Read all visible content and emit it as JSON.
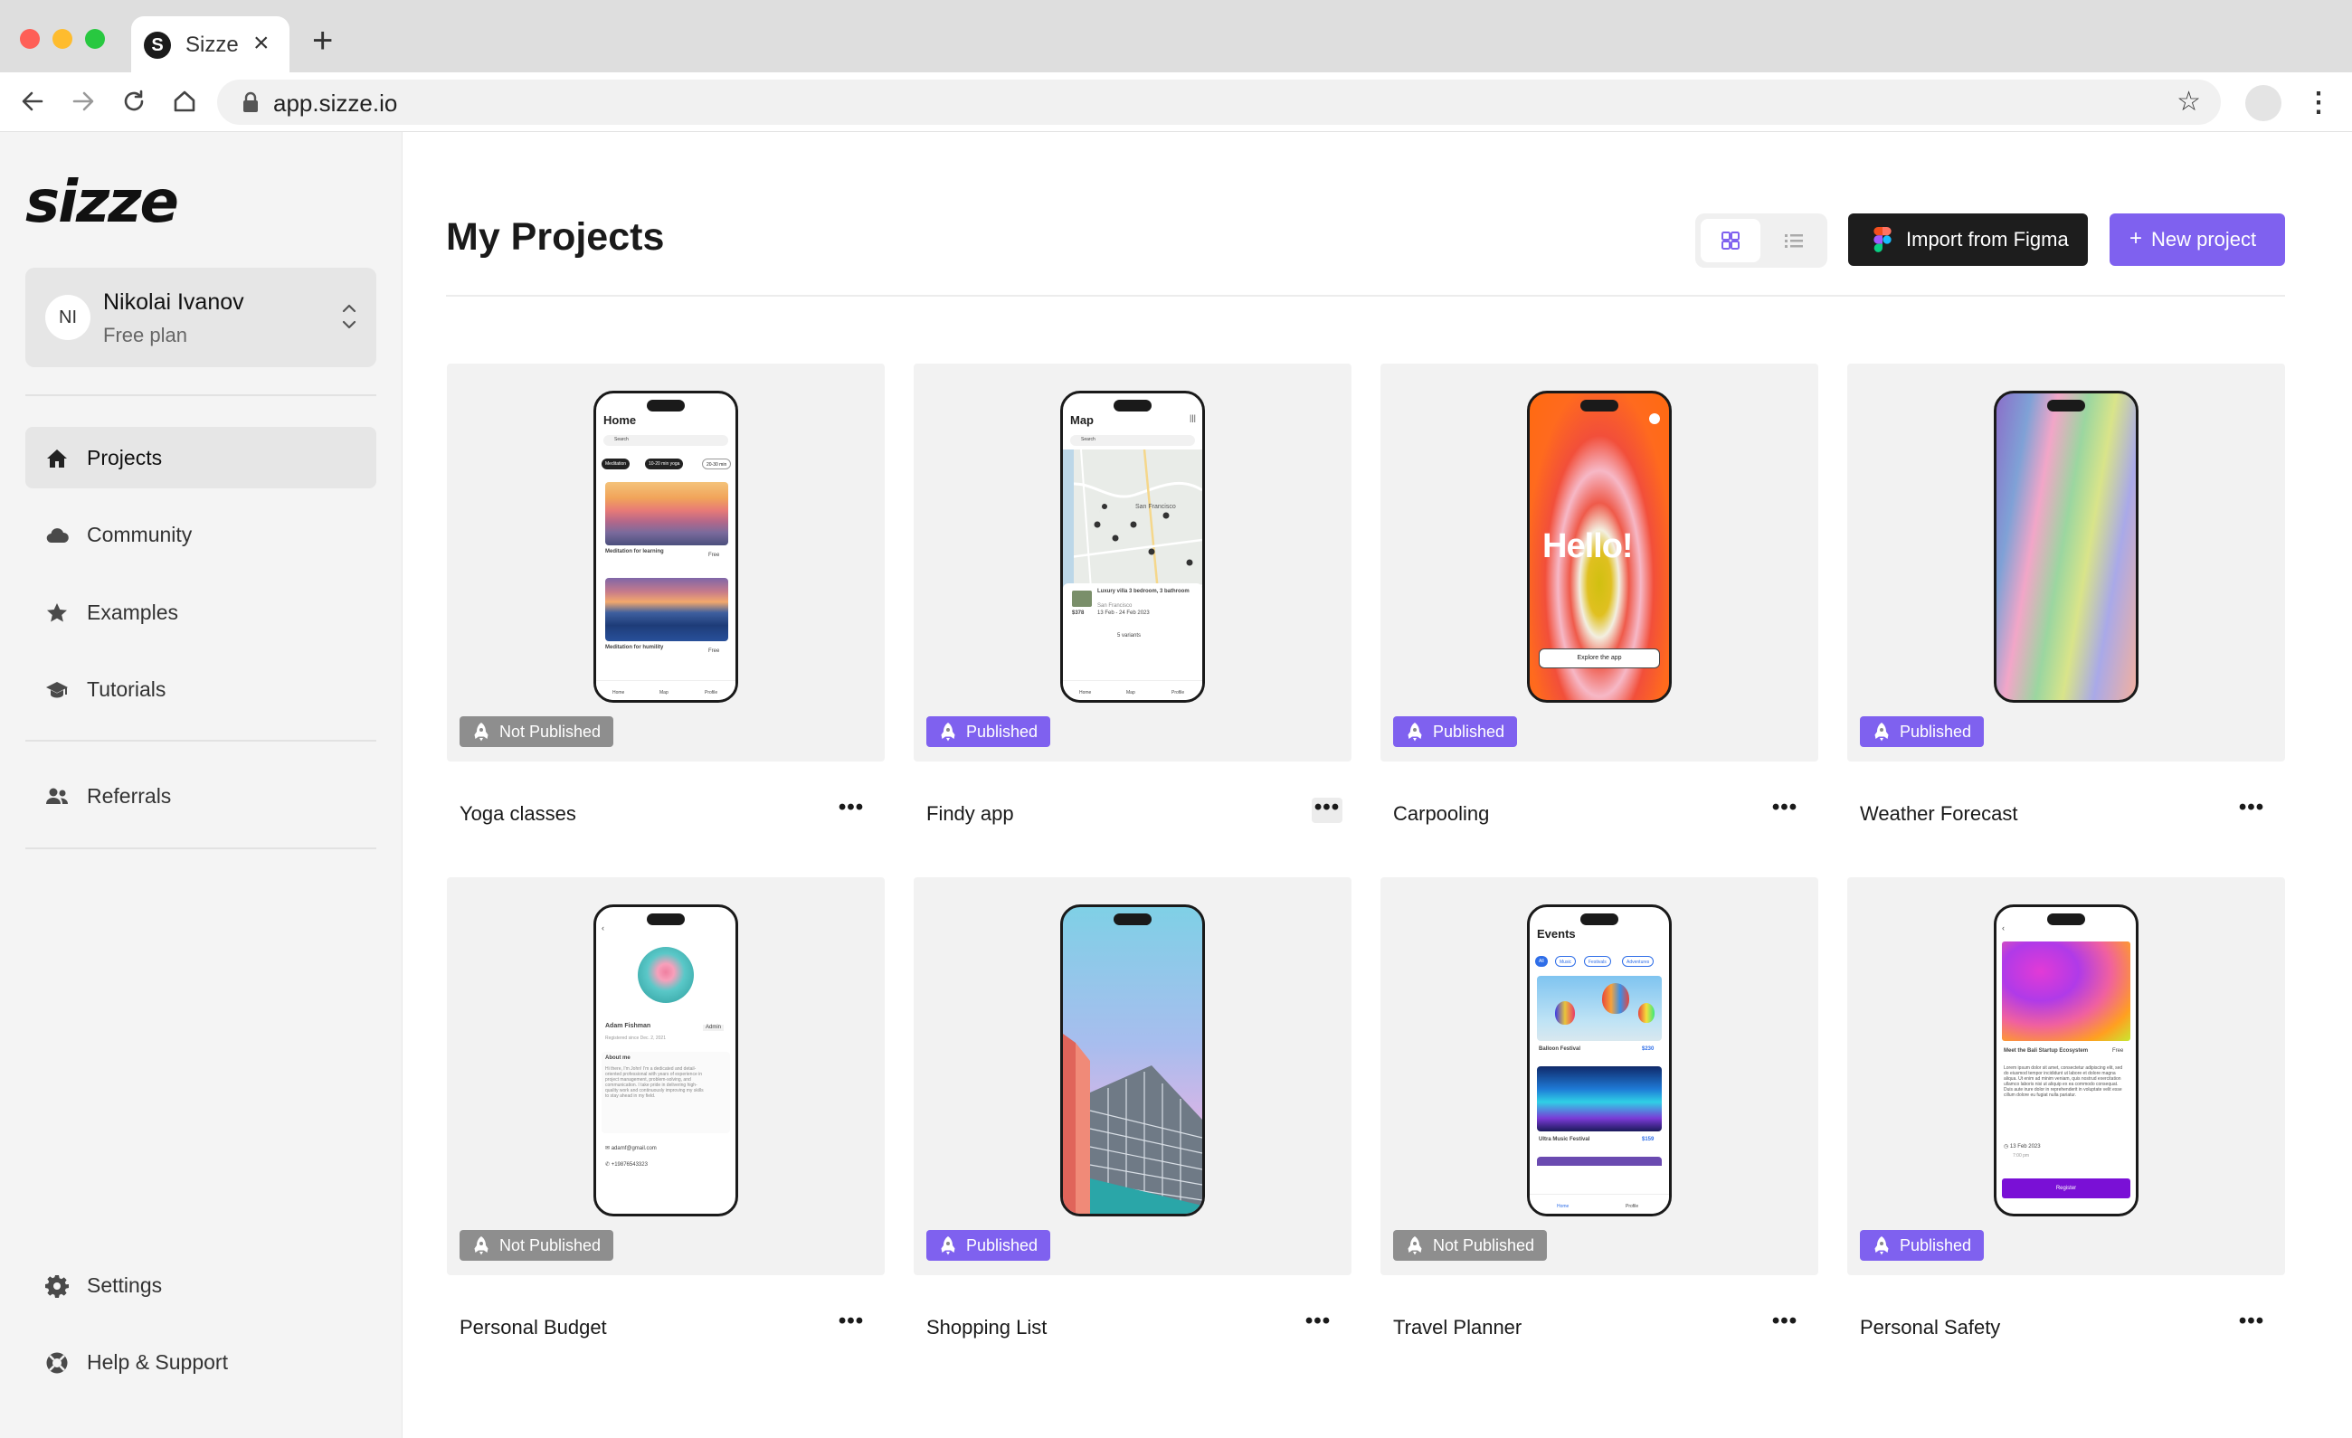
{
  "browser": {
    "tab_title": "Sizze",
    "tab_favicon": "S",
    "tab_close": "×",
    "new_tab": "+",
    "url": "app.sizze.io",
    "star": "☆",
    "menu": "⋮"
  },
  "sidebar": {
    "logo": "sizze",
    "user": {
      "initials": "NI",
      "name": "Nikolai Ivanov",
      "plan": "Free plan"
    },
    "nav": [
      {
        "label": "Projects",
        "icon": "home-icon",
        "active": true
      },
      {
        "label": "Community",
        "icon": "cloud-icon"
      },
      {
        "label": "Examples",
        "icon": "star-icon"
      },
      {
        "label": "Tutorials",
        "icon": "graduation-cap-icon"
      },
      {
        "label": "Referrals",
        "icon": "users-icon"
      }
    ],
    "bottom_nav": [
      {
        "label": "Settings",
        "icon": "gear-icon"
      },
      {
        "label": "Help & Support",
        "icon": "lifebuoy-icon"
      }
    ]
  },
  "main": {
    "title": "My Projects",
    "view_modes": [
      "grid-icon",
      "list-icon"
    ],
    "import_figma_label": "Import from Figma",
    "new_project_label": "New project",
    "new_project_plus": "+",
    "more_glyph": "•••"
  },
  "colors": {
    "accent": "#7f61ef",
    "published_badge": "#7f61ef",
    "not_published_badge": "#8e8e8e",
    "figma_button": "#1d1d1d"
  },
  "projects": [
    {
      "name": "Yoga classes",
      "status": "Not Published"
    },
    {
      "name": "Findy app",
      "status": "Published"
    },
    {
      "name": "Carpooling",
      "status": "Published"
    },
    {
      "name": "Weather Forecast",
      "status": "Published"
    },
    {
      "name": "Personal Budget",
      "status": "Not Published"
    },
    {
      "name": "Shopping List",
      "status": "Published"
    },
    {
      "name": "Travel Planner",
      "status": "Not Published"
    },
    {
      "name": "Personal Safety",
      "status": "Published"
    }
  ],
  "previews": {
    "yoga": {
      "title": "Home",
      "search": "Search",
      "chips": [
        "Meditation",
        "10-20 min yoga",
        "20-30 min"
      ],
      "item1": "Meditation for learning",
      "item1_tag": "Free",
      "item2": "Meditation for humility",
      "item2_tag": "Free",
      "tabs": [
        "Home",
        "Map",
        "Profile"
      ]
    },
    "findy": {
      "title": "Map",
      "search": "Search",
      "city": "San Francisco",
      "listing": "Luxury villa 3 bedroom, 3 bathroom",
      "listing_city": "San Francisco",
      "price": "$378",
      "dates": "13 Feb - 24 Feb 2023",
      "variants": "5 variants",
      "tabs": [
        "Home",
        "Map",
        "Profile"
      ]
    },
    "carpooling": {
      "hello": "Hello!",
      "cta": "Explore the app"
    },
    "budget": {
      "name": "Adam Fishman",
      "role": "Admin",
      "registered": "Registered since Dec. 2, 2021",
      "about_title": "About me",
      "about": "Hi there, I'm John! I'm a dedicated and detail-oriented professional with years of experience in project management, problem-solving, and communication. I take pride in delivering high-quality work and continuously improving my skills to stay ahead in my field.",
      "email": "adamf@gmail.com",
      "phone": "+19876543323"
    },
    "travel": {
      "title": "Events",
      "chips": [
        "All",
        "Music",
        "Festivals",
        "Adventures"
      ],
      "event1": "Balloon Festival",
      "price1": "$230",
      "event2": "Ultra Music Festival",
      "price2": "$159",
      "tabs": [
        "Home",
        "Profile"
      ]
    },
    "safety": {
      "title": "Meet the Bali Startup Ecosystem",
      "tag": "Free",
      "body": "Lorem ipsum dolor sit amet, consectetur adipiscing elit, sed do eiusmod tempor incididunt ut labore et dolore magna aliqua. Ut enim ad minim veniam, quis nostrud exercitation ullamco laboris nisi ut aliquip ex ea commodo consequat. Duis aute irure dolor in reprehenderit in voluptate velit esse cillum dolore eu fugiat nulla pariatur.",
      "date": "13 Feb 2023",
      "time": "7:00 pm",
      "cta": "Register"
    }
  }
}
